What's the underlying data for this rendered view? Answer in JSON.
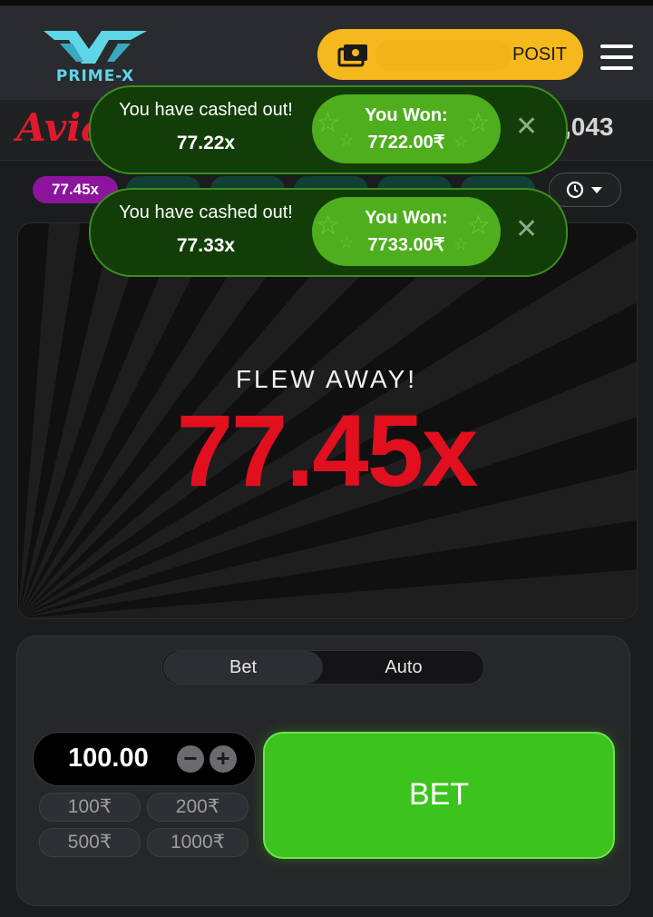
{
  "header": {
    "logo_text": "PRIME-X",
    "deposit_label": "POSIT",
    "menu_icon": "hamburger-icon"
  },
  "game_bar": {
    "title": "Avia",
    "balance": ",043"
  },
  "history": {
    "current": "77.45x",
    "icon": "history-clock-icon"
  },
  "toasts": [
    {
      "message": "You have cashed out!",
      "multiplier": "77.22x",
      "won_label": "You Won:",
      "amount": "7722.00₹"
    },
    {
      "message": "You have cashed out!",
      "multiplier": "77.33x",
      "won_label": "You Won:",
      "amount": "7733.00₹"
    }
  ],
  "game": {
    "status": "FLEW AWAY!",
    "multiplier": "77.45x"
  },
  "bet_panel": {
    "tabs": [
      "Bet",
      "Auto"
    ],
    "amount": "100.00",
    "quick_amounts": [
      "100₹",
      "200₹",
      "500₹",
      "1000₹"
    ],
    "bet_label": "BET"
  },
  "colors": {
    "accent_yellow": "#f5b81d",
    "multiplier_red": "#e20f1f",
    "bet_green": "#3cc31e",
    "history_purple": "#8d159e"
  }
}
